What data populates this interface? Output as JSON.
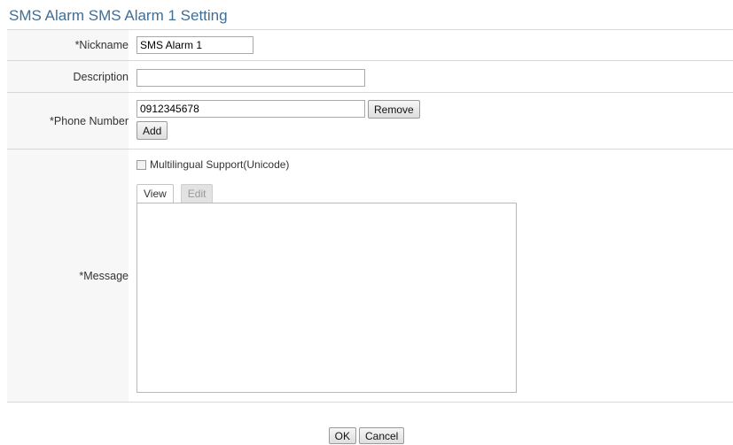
{
  "header": {
    "title": "SMS Alarm SMS Alarm 1 Setting"
  },
  "form": {
    "nickname": {
      "label": "*Nickname",
      "value": "SMS Alarm 1"
    },
    "description": {
      "label": "Description",
      "value": ""
    },
    "phone": {
      "label": "*Phone Number",
      "value": "0912345678",
      "remove_label": "Remove",
      "add_label": "Add"
    },
    "message": {
      "label": "*Message",
      "multilingual_label": "Multilingual Support(Unicode)",
      "multilingual_checked": false,
      "tabs": [
        {
          "label": "View",
          "active": true
        },
        {
          "label": "Edit",
          "active": false
        }
      ],
      "content": ""
    }
  },
  "actions": {
    "ok_label": "OK",
    "cancel_label": "Cancel"
  },
  "colors": {
    "title": "#3f6e96",
    "label_bg": "#f7f7f7",
    "border": "#d8d8d8"
  }
}
